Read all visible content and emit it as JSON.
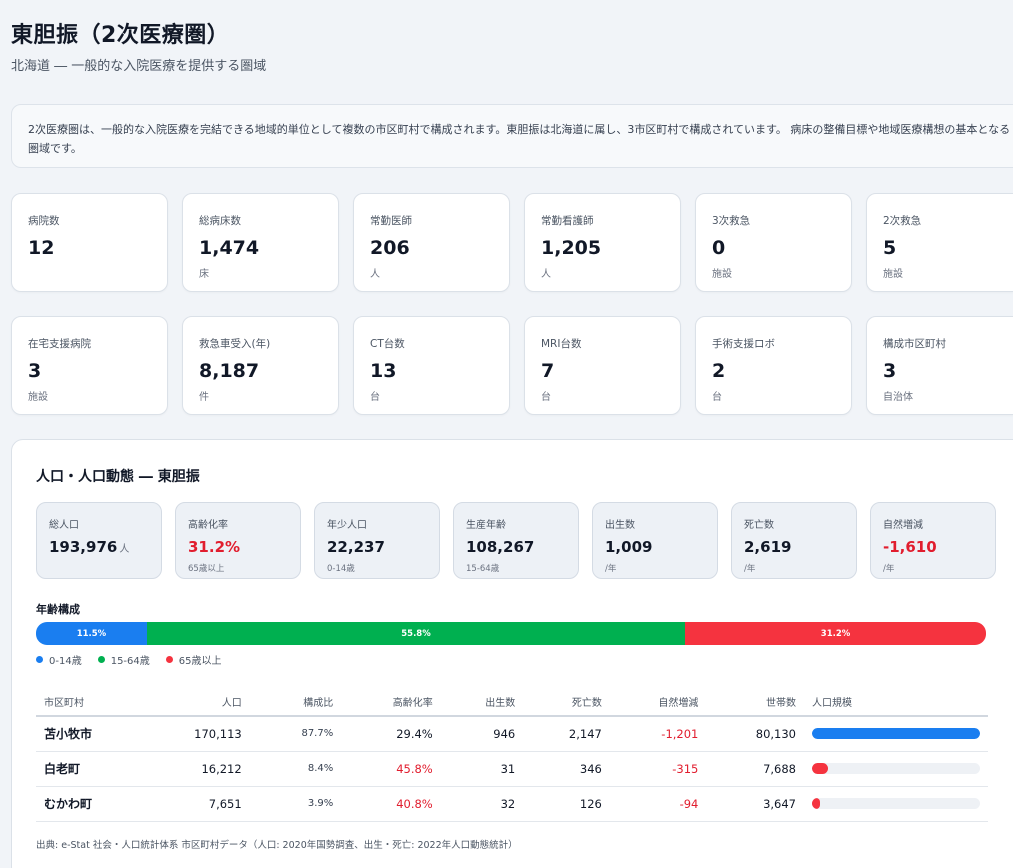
{
  "header": {
    "title": "東胆振（2次医療圏）",
    "subtitle": "北海道 ― 一般的な入院医療を提供する圏域"
  },
  "description": "2次医療圏は、一般的な入院医療を完結できる地域的単位として複数の市区町村で構成されます。東胆振は北海道に属し、3市区町村で構成されています。 病床の整備目標や地域医療構想の基本となる圏域です。",
  "stats_row1": [
    {
      "label": "病院数",
      "value": "12",
      "unit": ""
    },
    {
      "label": "総病床数",
      "value": "1,474",
      "unit": "床"
    },
    {
      "label": "常勤医師",
      "value": "206",
      "unit": "人"
    },
    {
      "label": "常勤看護師",
      "value": "1,205",
      "unit": "人"
    },
    {
      "label": "3次救急",
      "value": "0",
      "unit": "施設"
    },
    {
      "label": "2次救急",
      "value": "5",
      "unit": "施設"
    }
  ],
  "stats_row2": [
    {
      "label": "在宅支援病院",
      "value": "3",
      "unit": "施設"
    },
    {
      "label": "救急車受入(年)",
      "value": "8,187",
      "unit": "件"
    },
    {
      "label": "CT台数",
      "value": "13",
      "unit": "台"
    },
    {
      "label": "MRI台数",
      "value": "7",
      "unit": "台"
    },
    {
      "label": "手術支援ロボ",
      "value": "2",
      "unit": "台"
    },
    {
      "label": "構成市区町村",
      "value": "3",
      "unit": "自治体"
    }
  ],
  "population": {
    "title": "人口・人口動態 ― 東胆振",
    "cards": [
      {
        "label": "総人口",
        "value": "193,976",
        "unit": "人",
        "sub": ""
      },
      {
        "label": "高齢化率",
        "value": "31.2%",
        "unit": "",
        "sub": "65歳以上"
      },
      {
        "label": "年少人口",
        "value": "22,237",
        "unit": "",
        "sub": "0-14歳"
      },
      {
        "label": "生産年齢",
        "value": "108,267",
        "unit": "",
        "sub": "15-64歳"
      },
      {
        "label": "出生数",
        "value": "1,009",
        "unit": "",
        "sub": "/年"
      },
      {
        "label": "死亡数",
        "value": "2,619",
        "unit": "",
        "sub": "/年"
      },
      {
        "label": "自然増減",
        "value": "-1,610",
        "unit": "",
        "sub": "/年"
      }
    ],
    "age_title": "年齢構成",
    "age_segments": [
      {
        "label": "11.5%",
        "value": 11.5,
        "legend": "0-14歳",
        "color": "#1a7ef0"
      },
      {
        "label": "55.8%",
        "value": 55.8,
        "legend": "15-64歳",
        "color": "#00b050"
      },
      {
        "label": "31.2%",
        "value": 31.2,
        "legend": "65歳以上",
        "color": "#f5333f"
      }
    ],
    "table": {
      "headers": [
        "市区町村",
        "人口",
        "構成比",
        "高齢化率",
        "出生数",
        "死亡数",
        "自然増減",
        "世帯数",
        "人口規模"
      ],
      "rows": [
        {
          "name": "苫小牧市",
          "population": "170,113",
          "share": "87.7%",
          "aging": "29.4%",
          "births": "946",
          "deaths": "2,147",
          "natural": "-1,201",
          "households": "80,130",
          "scale": 1.0,
          "scale_color": "#1a7ef0"
        },
        {
          "name": "白老町",
          "population": "16,212",
          "share": "8.4%",
          "aging": "45.8%",
          "births": "31",
          "deaths": "346",
          "natural": "-315",
          "households": "7,688",
          "scale": 0.095,
          "scale_color": "#f5333f"
        },
        {
          "name": "むかわ町",
          "population": "7,651",
          "share": "3.9%",
          "aging": "40.8%",
          "births": "32",
          "deaths": "126",
          "natural": "-94",
          "households": "3,647",
          "scale": 0.045,
          "scale_color": "#f5333f"
        }
      ]
    },
    "source": "出典: e-Stat 社会・人口統計体系 市区町村データ（人口: 2020年国勢調査、出生・死亡: 2022年人口動態統計）"
  },
  "colors": {
    "accent_blue": "#1a7ef0",
    "accent_green": "#00b050",
    "accent_red": "#f5333f",
    "negative_text": "#e11d2e"
  }
}
